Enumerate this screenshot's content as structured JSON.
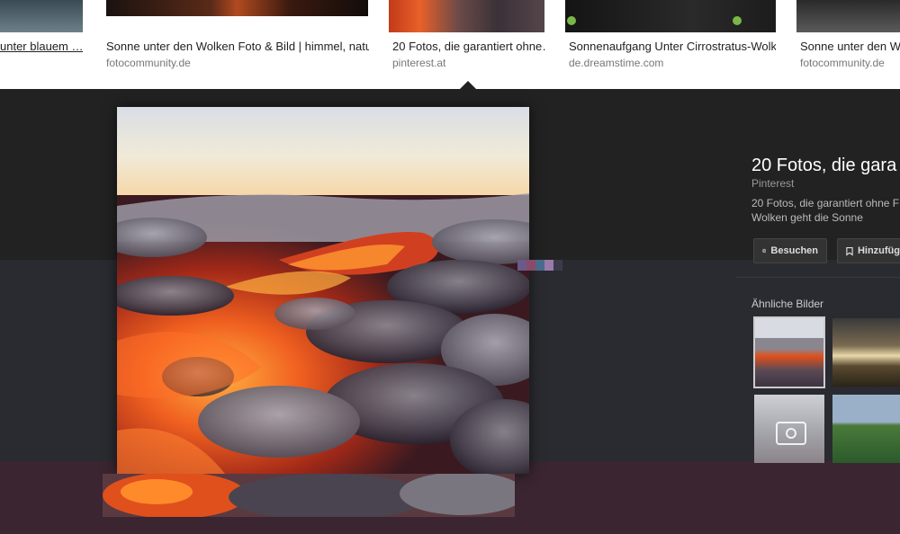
{
  "results": [
    {
      "title": "unter blauem …",
      "source": ""
    },
    {
      "title": "Sonne unter den Wolken Foto & Bild | himmel, natur…",
      "source": "fotocommunity.de"
    },
    {
      "title": "20 Fotos, die garantiert ohne…",
      "source": "pinterest.at"
    },
    {
      "title": "Sonnenaufgang Unter Cirrostratus-Wolk…",
      "source": "de.dreamstime.com"
    },
    {
      "title": "Sonne unter den Wolk",
      "source": "fotocommunity.de"
    }
  ],
  "panel": {
    "title": "20 Fotos, die gara",
    "source": "Pinterest",
    "description_line1": "20 Fotos, die garantiert ohne F",
    "description_line2": "Wolken geht die Sonne",
    "visit_button": "Besuchen",
    "save_button": "Hinzufüg",
    "related_title": "Ähnliche Bilder"
  },
  "icons": {
    "visit": "globe-icon",
    "save": "bookmark-icon",
    "placeholder": "camera-icon",
    "caret": "caret-up-icon"
  }
}
